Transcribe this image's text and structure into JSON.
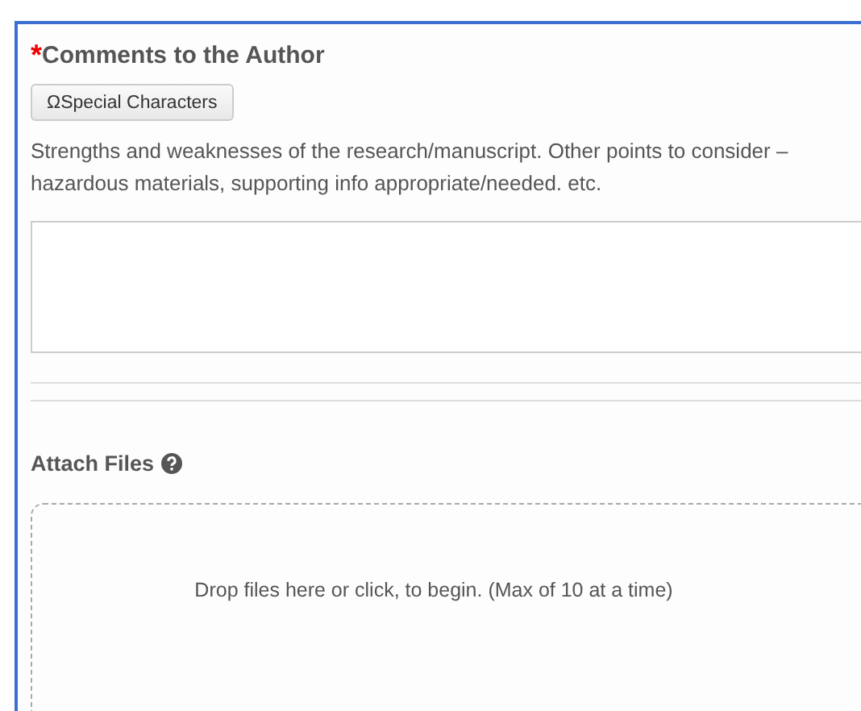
{
  "comments": {
    "title": "Comments to the Author",
    "required": true,
    "required_mark": "*",
    "special_button": "ΩSpecial Characters",
    "help_text": "Strengths and weaknesses of the research/manuscript. Other points to consider – hazardous materials, supporting info appropriate/needed. etc."
  },
  "attach": {
    "title": "Attach Files",
    "dropzone_text": "Drop files here or click, to begin. (Max of 10 at a time)"
  }
}
